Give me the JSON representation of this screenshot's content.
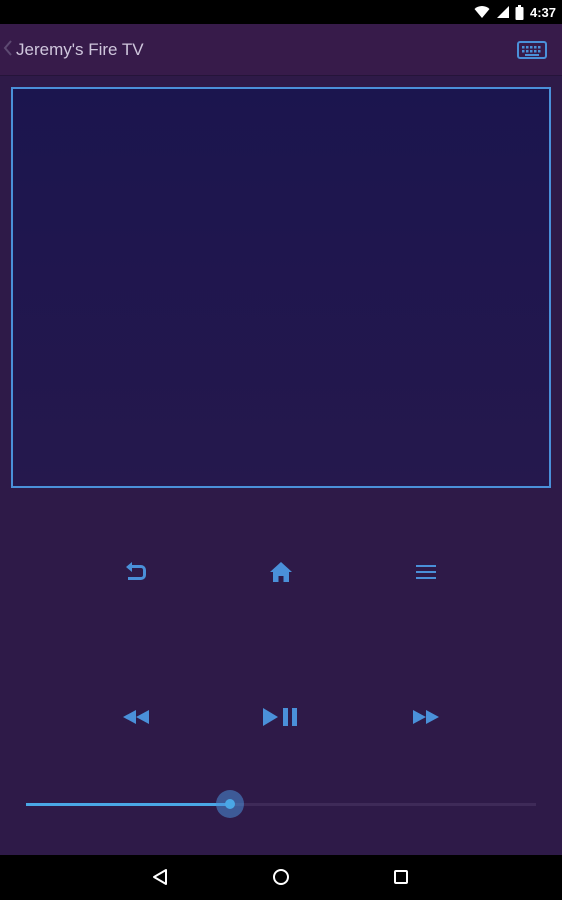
{
  "status_bar": {
    "time": "4:37",
    "icons": [
      "wifi-icon",
      "cell-signal-icon",
      "battery-icon"
    ]
  },
  "app_bar": {
    "title": "Jeremy's Fire TV",
    "action_icon": "keyboard-icon"
  },
  "touchpad": {
    "border_color": "#4a90d9"
  },
  "controls": {
    "row1": [
      "back-icon",
      "home-icon",
      "menu-icon"
    ],
    "row2": [
      "rewind-icon",
      "play-pause-icon",
      "fast-forward-icon"
    ]
  },
  "seek": {
    "value_fraction": 0.4
  },
  "nav_bar": {
    "icons": [
      "nav-back-icon",
      "nav-home-icon",
      "nav-recents-icon"
    ]
  },
  "colors": {
    "accent": "#4a90d9",
    "background": "#2e1a48",
    "app_bar": "#371b4a"
  }
}
